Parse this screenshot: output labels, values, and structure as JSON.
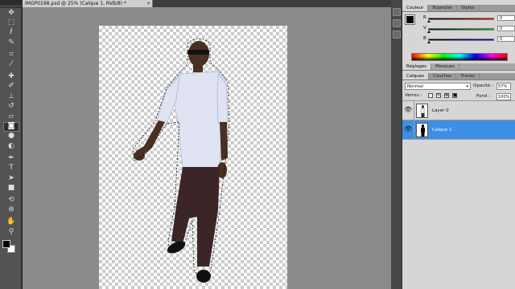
{
  "document": {
    "tab_title": "IMGP0198.psd @ 25% (Calque 1, RVB/8) *",
    "close_glyph": "×"
  },
  "tools": {
    "items": [
      "move-tool",
      "marquee-tool",
      "lasso-tool",
      "quick-selection-tool",
      "crop-tool",
      "eyedropper-tool",
      "healing-brush-tool",
      "brush-tool",
      "clone-stamp-tool",
      "history-brush-tool",
      "eraser-tool",
      "gradient-tool",
      "blur-tool",
      "dodge-tool",
      "pen-tool",
      "type-tool",
      "path-selection-tool",
      "shape-tool",
      "3d-rotate-tool",
      "3d-orbit-tool",
      "hand-tool",
      "zoom-tool"
    ],
    "selected": "quick-selection-tool"
  },
  "color_panel": {
    "tabs": [
      "Couleur",
      "Nuancier",
      "Styles"
    ],
    "active_tab": "Couleur",
    "channels": [
      {
        "label": "R",
        "value": "0"
      },
      {
        "label": "V",
        "value": "0"
      },
      {
        "label": "B",
        "value": "0"
      }
    ],
    "foreground": "#000000",
    "background": "#ffffff"
  },
  "adjust_panel": {
    "tabs": [
      "Réglages",
      "Masques"
    ],
    "active_tab": "Réglages"
  },
  "layers_panel": {
    "tabs": [
      "Calques",
      "Couches",
      "Tracés"
    ],
    "active_tab": "Calques",
    "blend_mode": "Normal",
    "opacity_label": "Opacité :",
    "opacity_value": "57%",
    "lock_label": "Verrou :",
    "fill_label": "Fond :",
    "fill_value": "100%",
    "layers": [
      {
        "name": "Layer 0",
        "selected": false,
        "visible": true
      },
      {
        "name": "Calque 1",
        "selected": true,
        "visible": true
      }
    ]
  },
  "colors": {
    "selection_blue": "#3d8ee5",
    "panel_gray": "#d6d6d6",
    "workspace_gray": "#8b8b8b"
  }
}
